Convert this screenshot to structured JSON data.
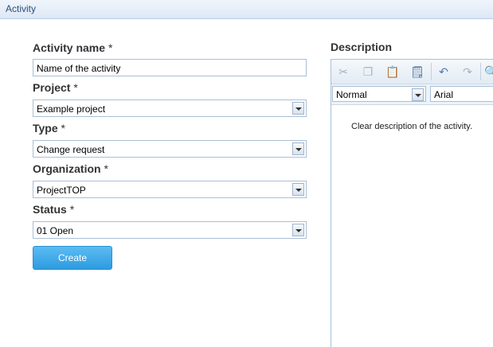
{
  "window": {
    "title": "Activity"
  },
  "form": {
    "activity_name": {
      "label": "Activity name",
      "required": "*",
      "value": "Name of the activity"
    },
    "project": {
      "label": "Project",
      "required": "*",
      "value": "Example project"
    },
    "type": {
      "label": "Type",
      "required": "*",
      "value": "Change request"
    },
    "organization": {
      "label": "Organization",
      "required": "*",
      "value": "ProjectTOP"
    },
    "status": {
      "label": "Status",
      "required": "*",
      "value": "01 Open"
    },
    "create_label": "Create"
  },
  "description": {
    "label": "Description",
    "toolbar": {
      "icons": [
        "cut-icon",
        "copy-icon",
        "paste-icon",
        "paste-word-icon",
        "undo-icon",
        "redo-icon",
        "find-icon"
      ]
    },
    "format_value": "Normal",
    "font_value": "Arial",
    "content": "Clear description of the activity."
  },
  "colors": {
    "accent": "#2d9be0",
    "titlebar": "#dde8f5",
    "label": "#333333"
  }
}
